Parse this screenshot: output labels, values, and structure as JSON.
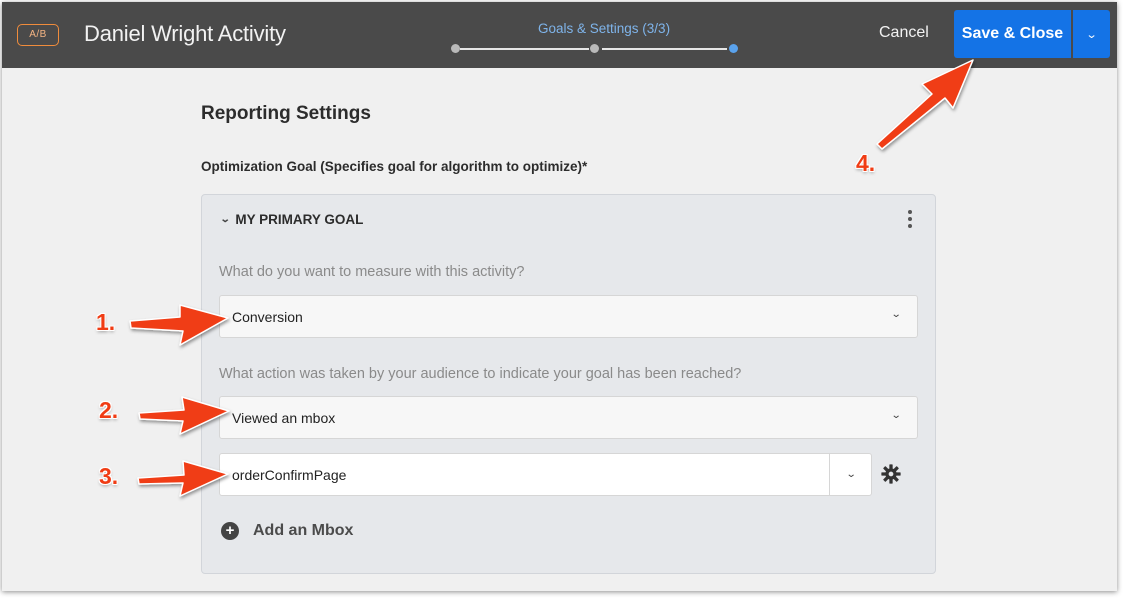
{
  "header": {
    "badge": "A/B",
    "title": "Daniel Wright Activity",
    "step_label": "Goals & Settings (3/3)",
    "cancel_label": "Cancel",
    "save_label": "Save & Close",
    "progress_steps": 3,
    "current_step": 3
  },
  "content": {
    "section_title": "Reporting Settings",
    "goal_label": "Optimization Goal (Specifies goal for algorithm to optimize)*",
    "goal_card": {
      "header": "MY PRIMARY GOAL",
      "question1": "What do you want to measure with this activity?",
      "measure_value": "Conversion",
      "question2": "What action was taken by your audience to indicate your goal has been reached?",
      "action_value": "Viewed an mbox",
      "mbox_value": "orderConfirmPage",
      "add_mbox_label": "Add an Mbox"
    }
  },
  "annotations": {
    "n1": "1.",
    "n2": "2.",
    "n3": "3.",
    "n4": "4."
  },
  "colors": {
    "header_bg": "#4a4a4a",
    "accent_blue": "#1473e6",
    "step_blue": "#7fb4ea",
    "badge_orange": "#f08c3c",
    "arrow_red": "#f03c14"
  }
}
